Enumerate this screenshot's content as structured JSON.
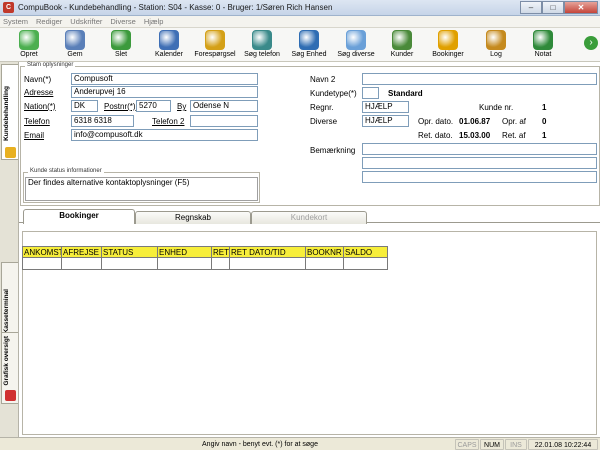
{
  "window": {
    "title": "CompuBook - Kundebehandling - Station: S04 - Kasse: 0 - Bruger: 1/Søren Rich Hansen",
    "minimize": "–",
    "maximize": "□",
    "close": "✕"
  },
  "menu": [
    "System",
    "Rediger",
    "Udskrifter",
    "Diverse",
    "Hjælp"
  ],
  "toolbar": [
    {
      "label": "Opret",
      "icon": "add-person-icon",
      "color": "#4caf50"
    },
    {
      "label": "Gem",
      "icon": "save-person-icon",
      "color": "#5a7fb8"
    },
    {
      "label": "Slet",
      "icon": "delete-person-icon",
      "color": "#3c9a3c"
    },
    {
      "label": "Kalender",
      "icon": "calendar-icon",
      "color": "#3f6fb5"
    },
    {
      "label": "Forespørgsel",
      "icon": "question-icon",
      "color": "#d4a017"
    },
    {
      "label": "Søg telefon",
      "icon": "search-phone-icon",
      "color": "#3a8a8a"
    },
    {
      "label": "Søg Enhed",
      "icon": "search-unit-icon",
      "color": "#2f6db3"
    },
    {
      "label": "Søg diverse",
      "icon": "magnifier-icon",
      "color": "#6aa0d8"
    },
    {
      "label": "Kunder",
      "icon": "customers-icon",
      "color": "#4a8a3a"
    },
    {
      "label": "Bookinger",
      "icon": "bookings-star-icon",
      "color": "#e0a000"
    },
    {
      "label": "Log",
      "icon": "log-jar-icon",
      "color": "#c58a1e"
    },
    {
      "label": "Notat",
      "icon": "note-person-icon",
      "color": "#2f8a3a"
    }
  ],
  "toolbar_next": "›",
  "side_tabs": [
    {
      "label": "Kundebehandling",
      "icon": "customer-flag-icon",
      "color": "#e8b020"
    },
    {
      "label": "Kasseterminal",
      "icon": "terminal-icon",
      "color": "#888888"
    },
    {
      "label": "Grafisk oversigt",
      "icon": "chart-icon",
      "color": "#d03030"
    }
  ],
  "stam": {
    "group_label": "Stam oplysninger",
    "navn_label": "Navn(*)",
    "navn": "Compusoft",
    "adresse_label": "Adresse",
    "adresse": "Anderupvej 16",
    "nation_label": "Nation(*)",
    "nation": "DK",
    "postnr_label": "Postnr(*)",
    "postnr": "5270",
    "by_label": "By",
    "by": "Odense N",
    "telefon_label": "Telefon",
    "telefon": "6318 6318",
    "telefon2_label": "Telefon 2",
    "telefon2": "",
    "email_label": "Email",
    "email": "info@compusoft.dk",
    "navn2_label": "Navn 2",
    "navn2": "",
    "kundetype_label": "Kundetype(*)",
    "kundetype_value": "Standard",
    "regnr_label": "Regnr.",
    "regnr": "HJÆLP",
    "kundenr_label": "Kunde nr.",
    "kundenr": "1",
    "diverse_label": "Diverse",
    "diverse": "HJÆLP",
    "opr_dato_label": "Opr. dato.",
    "opr_dato": "01.06.87",
    "opr_af_label": "Opr. af",
    "opr_af": "0",
    "ret_dato_label": "Ret. dato.",
    "ret_dato": "15.03.00",
    "ret_af_label": "Ret. af",
    "ret_af": "1",
    "bemaerkning_label": "Bemærkning"
  },
  "status_info": {
    "group_label": "Kunde status informationer",
    "text": "Der findes alternative kontaktoplysninger (F5)"
  },
  "tabs": [
    {
      "label": "Bookinger",
      "state": "active"
    },
    {
      "label": "Regnskab",
      "state": "normal"
    },
    {
      "label": "Kundekort",
      "state": "disabled"
    }
  ],
  "bookings_table": {
    "columns": [
      "ANKOMST",
      "AFREJSE",
      "STATUS",
      "ENHED",
      "RET",
      "RET DATO/TID",
      "BOOKNR",
      "SALDO"
    ],
    "rows": []
  },
  "statusbar": {
    "hint": "Angiv navn - benyt evt. (*) for at søge",
    "caps": "CAPS",
    "num": "NUM",
    "ins": "INS",
    "datetime": "22.01.08 10:22:44"
  }
}
